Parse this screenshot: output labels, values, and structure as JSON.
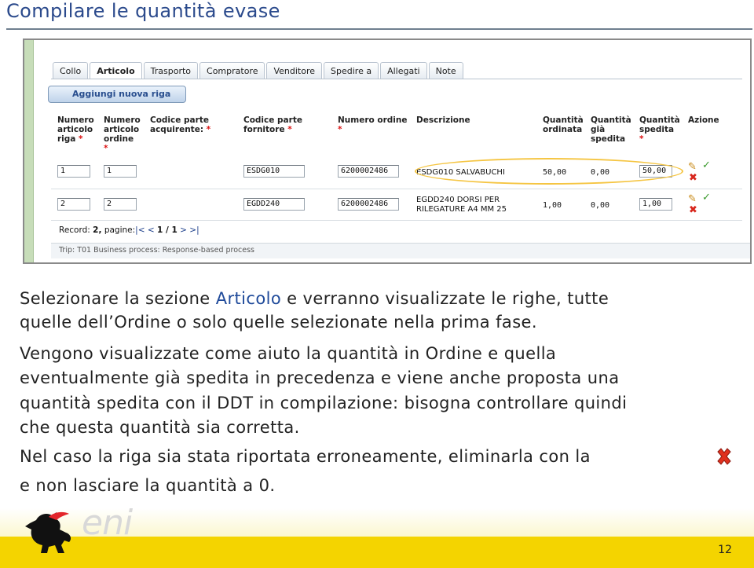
{
  "slide": {
    "title": "Compilare le quantità evase",
    "page_number": "12"
  },
  "ui": {
    "tabs": [
      {
        "label": "Collo",
        "active": false
      },
      {
        "label": "Articolo",
        "active": true
      },
      {
        "label": "Trasporto",
        "active": false
      },
      {
        "label": "Compratore",
        "active": false
      },
      {
        "label": "Venditore",
        "active": false
      },
      {
        "label": "Spedire a",
        "active": false
      },
      {
        "label": "Allegati",
        "active": false
      },
      {
        "label": "Note",
        "active": false
      }
    ],
    "add_row_label": "Aggiungi nuova riga",
    "columns": {
      "riga": "Numero\narticolo\nriga",
      "ordine": "Numero\narticolo\nordine",
      "acquirente": "Codice parte\nacquirente:",
      "fornitore": "Codice parte\nfornitore",
      "numero_ordine": "Numero ordine",
      "descrizione": "Descrizione",
      "q_ordinata": "Quantità\nordinata",
      "q_spedita_gia": "Quantità\ngià\nspedita",
      "q_spedita": "Quantità\nspedita",
      "azione": "Azione"
    },
    "required_mark": "*",
    "rows": [
      {
        "riga": "1",
        "ordine": "1",
        "fornitore": "ESDG010",
        "numero_ordine": "6200002486",
        "descrizione": "ESDG010 SALVABUCHI",
        "q_ordinata": "50,00",
        "q_gia_spedita": "0,00",
        "q_spedita": "50,00"
      },
      {
        "riga": "2",
        "ordine": "2",
        "fornitore": "EGDD240",
        "numero_ordine": "6200002486",
        "descrizione_line1": "EGDD240 DORSI PER",
        "descrizione_line2": "RILEGATURE A4 MM 25",
        "q_ordinata": "1,00",
        "q_gia_spedita": "0,00",
        "q_spedita": "1,00"
      }
    ],
    "pager": {
      "prefix": "Record:",
      "record_count": "2,",
      "pages_label": "pagine:",
      "first": "|<",
      "prev": "<",
      "current": "1 / 1",
      "next": ">",
      "last": ">|"
    },
    "trip_text": "Trip: T01 Business process: Response-based process",
    "icons": {
      "edit": "edit-icon",
      "confirm": "confirm-icon",
      "delete": "delete-icon"
    }
  },
  "body": {
    "p1_a": "Selezionare la sezione ",
    "p1_kw": "Articolo",
    "p1_b": " e verranno visualizzate le righe, tutte",
    "p1_line2": "quelle dell’Ordine o solo quelle selezionate nella prima fase.",
    "p2_line1": "Vengono visualizzate come aiuto la quantità in Ordine e quella",
    "p2_line2": "eventualmente già spedita in precedenza e viene anche proposta una",
    "p2_line3": "quantità spedita con il DDT in compilazione: bisogna controllare quindi",
    "p2_line4": "che questa quantità sia corretta.",
    "p3_line1": "Nel caso la riga sia stata riportata erroneamente, eliminarla con la",
    "p3_line2": "e non lasciare la quantità a 0."
  },
  "colors": {
    "title": "#2b4a8c",
    "keyword": "#1f4a9a",
    "highlight": "#f5c542",
    "footer": "#f4d400"
  }
}
